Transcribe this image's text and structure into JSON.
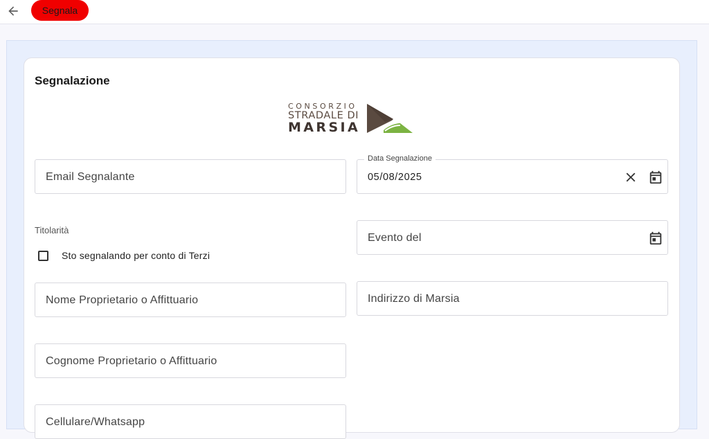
{
  "header": {
    "back_icon": "arrow-left-icon",
    "report_button_label": "Segnala",
    "report_button_color": "#f00000"
  },
  "form": {
    "title": "Segnalazione",
    "logo": {
      "line1": "CONSORZIO",
      "line2": "STRADALE DI",
      "line3": "MARSIA",
      "colors": {
        "mountain": "#5a4a40",
        "road": "#7cb342"
      }
    },
    "email": {
      "placeholder": "Email Segnalante"
    },
    "report_date": {
      "label": "Data Segnalazione",
      "value": "05/08/2025",
      "clear_icon": "close-icon",
      "calendar_icon": "calendar-icon"
    },
    "ownership": {
      "label": "Titolarità",
      "third_party_checkbox": {
        "label": "Sto segnalando per conto di Terzi",
        "checked": false
      }
    },
    "event_date": {
      "placeholder": "Evento del",
      "calendar_icon": "calendar-icon"
    },
    "owner_name": {
      "placeholder": "Nome Proprietario o Affittuario"
    },
    "address": {
      "placeholder": "Indirizzo di Marsia"
    },
    "owner_surname": {
      "placeholder": "Cognome Proprietario o Affittuario"
    },
    "phone": {
      "placeholder": "Cellulare/Whatsapp"
    }
  }
}
